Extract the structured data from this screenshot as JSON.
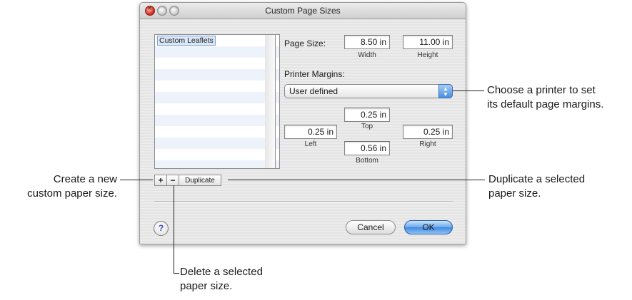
{
  "window": {
    "title": "Custom Page Sizes"
  },
  "sizes_list": {
    "items": [
      "Custom Leaflets"
    ]
  },
  "list_buttons": {
    "add": "+",
    "remove": "−",
    "duplicate": "Duplicate"
  },
  "page_size": {
    "label": "Page Size:",
    "width_value": "8.50 in",
    "width_label": "Width",
    "height_value": "11.00 in",
    "height_label": "Height"
  },
  "margins": {
    "label": "Printer Margins:",
    "selected": "User defined",
    "top_value": "0.25 in",
    "top_label": "Top",
    "left_value": "0.25 in",
    "left_label": "Left",
    "right_value": "0.25 in",
    "right_label": "Right",
    "bottom_value": "0.56 in",
    "bottom_label": "Bottom"
  },
  "buttons": {
    "help": "?",
    "cancel": "Cancel",
    "ok": "OK"
  },
  "callouts": {
    "printer_line1": "Choose a printer to set",
    "printer_line2": "its default page margins.",
    "create_line1": "Create a new",
    "create_line2": "custom paper size.",
    "duplicate_line1": "Duplicate a selected",
    "duplicate_line2": "paper size.",
    "delete_line1": "Delete a selected",
    "delete_line2": "paper size."
  },
  "colors": {
    "accent": "#4a8ee0",
    "close_button": "#d8362a"
  },
  "icons": [
    "close-window-icon",
    "minimize-window-icon",
    "zoom-window-icon",
    "popup-arrows-icon",
    "help-icon"
  ]
}
